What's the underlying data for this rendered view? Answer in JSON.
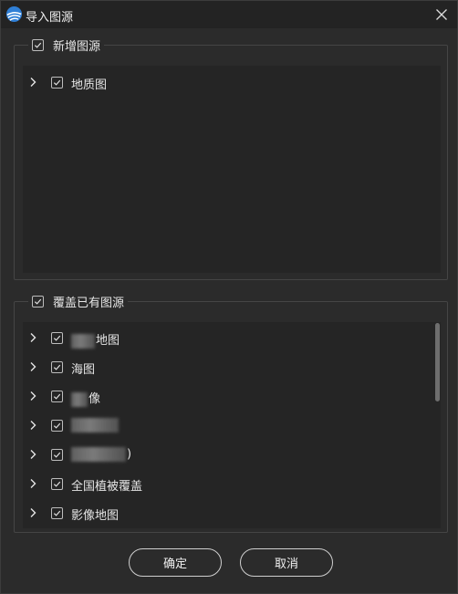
{
  "window": {
    "title": "导入图源",
    "icon": "app-logo-icon",
    "close_icon": "close-icon"
  },
  "group_new": {
    "label": "新增图源",
    "checked": true,
    "items": [
      {
        "label": "地质图",
        "checked": true,
        "expanded": false
      }
    ]
  },
  "group_overwrite": {
    "label": "覆盖已有图源",
    "checked": true,
    "items": [
      {
        "label": "地图",
        "checked": true,
        "expanded": false,
        "redacted_prefix": true
      },
      {
        "label": "海图",
        "checked": true,
        "expanded": false
      },
      {
        "label": "像",
        "checked": true,
        "expanded": false,
        "redacted_prefix": true
      },
      {
        "label": "",
        "checked": true,
        "expanded": false,
        "redacted_prefix": true
      },
      {
        "label": ")",
        "checked": true,
        "expanded": false,
        "redacted_prefix": true
      },
      {
        "label": "全国植被覆盖",
        "checked": true,
        "expanded": false
      },
      {
        "label": "影像地图",
        "checked": true,
        "expanded": false
      }
    ]
  },
  "buttons": {
    "ok": "确定",
    "cancel": "取消"
  },
  "colors": {
    "background": "#2b2b2b",
    "panel": "#252525",
    "titlebar": "#232323",
    "text": "#e6e6e6",
    "border": "#454545",
    "logo_blue": "#2f7fd6"
  }
}
